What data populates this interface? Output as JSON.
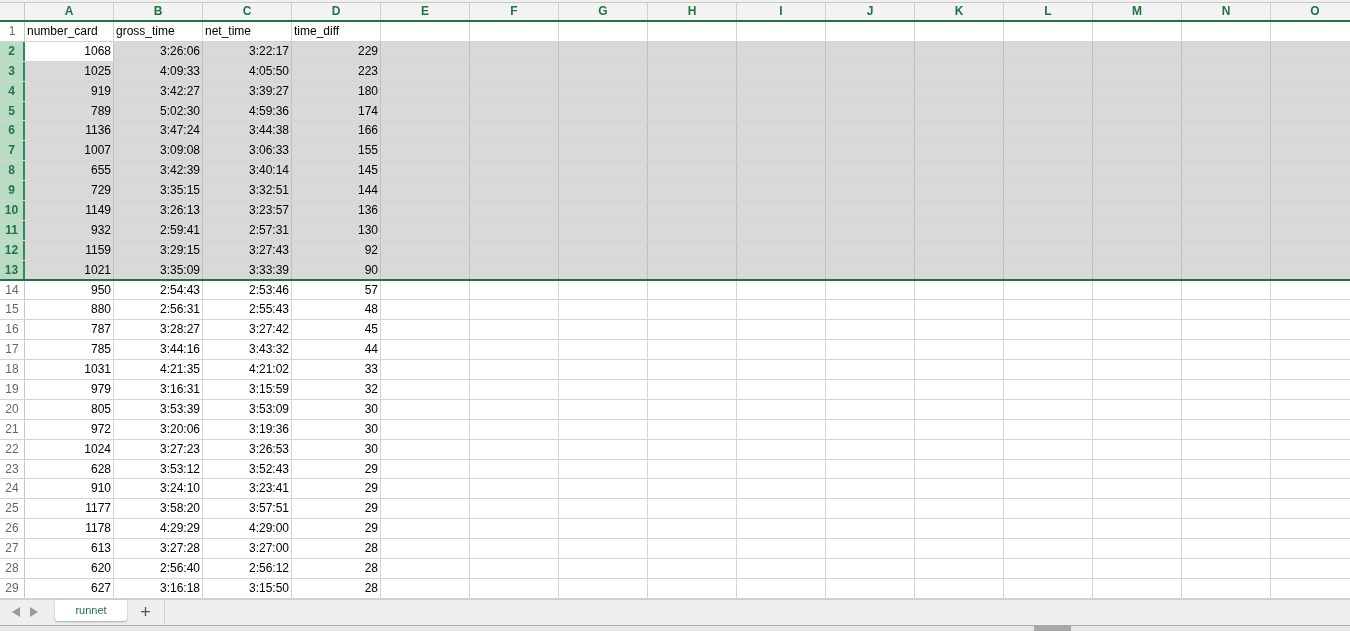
{
  "columns": [
    {
      "label": "A",
      "selected": true
    },
    {
      "label": "B",
      "selected": true
    },
    {
      "label": "C",
      "selected": true
    },
    {
      "label": "D",
      "selected": true
    },
    {
      "label": "E",
      "selected": true
    },
    {
      "label": "F",
      "selected": true
    },
    {
      "label": "G",
      "selected": true
    },
    {
      "label": "H",
      "selected": true
    },
    {
      "label": "I",
      "selected": true
    },
    {
      "label": "J",
      "selected": true
    },
    {
      "label": "K",
      "selected": true
    },
    {
      "label": "L",
      "selected": true
    },
    {
      "label": "M",
      "selected": true
    },
    {
      "label": "N",
      "selected": true
    },
    {
      "label": "O",
      "selected": true
    }
  ],
  "header_row": {
    "number": "1",
    "cells": [
      "number_card",
      "gross_time",
      "net_time",
      "time_diff"
    ],
    "selected": false,
    "active": false
  },
  "rows": [
    {
      "number": "2",
      "cells": [
        "1068",
        "3:26:06",
        "3:22:17",
        "229"
      ],
      "selected": true,
      "active": true
    },
    {
      "number": "3",
      "cells": [
        "1025",
        "4:09:33",
        "4:05:50",
        "223"
      ],
      "selected": true,
      "active": false
    },
    {
      "number": "4",
      "cells": [
        "919",
        "3:42:27",
        "3:39:27",
        "180"
      ],
      "selected": true,
      "active": false
    },
    {
      "number": "5",
      "cells": [
        "789",
        "5:02:30",
        "4:59:36",
        "174"
      ],
      "selected": true,
      "active": false
    },
    {
      "number": "6",
      "cells": [
        "1136",
        "3:47:24",
        "3:44:38",
        "166"
      ],
      "selected": true,
      "active": false
    },
    {
      "number": "7",
      "cells": [
        "1007",
        "3:09:08",
        "3:06:33",
        "155"
      ],
      "selected": true,
      "active": false
    },
    {
      "number": "8",
      "cells": [
        "655",
        "3:42:39",
        "3:40:14",
        "145"
      ],
      "selected": true,
      "active": false
    },
    {
      "number": "9",
      "cells": [
        "729",
        "3:35:15",
        "3:32:51",
        "144"
      ],
      "selected": true,
      "active": false
    },
    {
      "number": "10",
      "cells": [
        "1149",
        "3:26:13",
        "3:23:57",
        "136"
      ],
      "selected": true,
      "active": false
    },
    {
      "number": "11",
      "cells": [
        "932",
        "2:59:41",
        "2:57:31",
        "130"
      ],
      "selected": true,
      "active": false
    },
    {
      "number": "12",
      "cells": [
        "1159",
        "3:29:15",
        "3:27:43",
        "92"
      ],
      "selected": true,
      "active": false
    },
    {
      "number": "13",
      "cells": [
        "1021",
        "3:35:09",
        "3:33:39",
        "90"
      ],
      "selected": true,
      "active": false
    },
    {
      "number": "14",
      "cells": [
        "950",
        "2:54:43",
        "2:53:46",
        "57"
      ],
      "selected": false,
      "active": false
    },
    {
      "number": "15",
      "cells": [
        "880",
        "2:56:31",
        "2:55:43",
        "48"
      ],
      "selected": false,
      "active": false
    },
    {
      "number": "16",
      "cells": [
        "787",
        "3:28:27",
        "3:27:42",
        "45"
      ],
      "selected": false,
      "active": false
    },
    {
      "number": "17",
      "cells": [
        "785",
        "3:44:16",
        "3:43:32",
        "44"
      ],
      "selected": false,
      "active": false
    },
    {
      "number": "18",
      "cells": [
        "1031",
        "4:21:35",
        "4:21:02",
        "33"
      ],
      "selected": false,
      "active": false
    },
    {
      "number": "19",
      "cells": [
        "979",
        "3:16:31",
        "3:15:59",
        "32"
      ],
      "selected": false,
      "active": false
    },
    {
      "number": "20",
      "cells": [
        "805",
        "3:53:39",
        "3:53:09",
        "30"
      ],
      "selected": false,
      "active": false
    },
    {
      "number": "21",
      "cells": [
        "972",
        "3:20:06",
        "3:19:36",
        "30"
      ],
      "selected": false,
      "active": false
    },
    {
      "number": "22",
      "cells": [
        "1024",
        "3:27:23",
        "3:26:53",
        "30"
      ],
      "selected": false,
      "active": false
    },
    {
      "number": "23",
      "cells": [
        "628",
        "3:53:12",
        "3:52:43",
        "29"
      ],
      "selected": false,
      "active": false
    },
    {
      "number": "24",
      "cells": [
        "910",
        "3:24:10",
        "3:23:41",
        "29"
      ],
      "selected": false,
      "active": false
    },
    {
      "number": "25",
      "cells": [
        "1177",
        "3:58:20",
        "3:57:51",
        "29"
      ],
      "selected": false,
      "active": false
    },
    {
      "number": "26",
      "cells": [
        "1178",
        "4:29:29",
        "4:29:00",
        "29"
      ],
      "selected": false,
      "active": false
    },
    {
      "number": "27",
      "cells": [
        "613",
        "3:27:28",
        "3:27:00",
        "28"
      ],
      "selected": false,
      "active": false
    },
    {
      "number": "28",
      "cells": [
        "620",
        "2:56:40",
        "2:56:12",
        "28"
      ],
      "selected": false,
      "active": false
    },
    {
      "number": "29",
      "cells": [
        "627",
        "3:16:18",
        "3:15:50",
        "28"
      ],
      "selected": false,
      "active": false
    }
  ],
  "sheet_tabs": [
    {
      "label": "runnet",
      "selected": true
    }
  ],
  "add_sheet": "+"
}
